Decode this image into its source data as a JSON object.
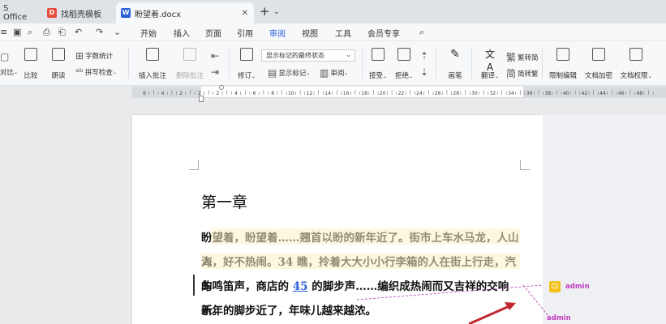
{
  "tabs": [
    {
      "label": "S Office",
      "icon": "wps-office-icon"
    },
    {
      "label": "找稻壳模板",
      "icon": "docer-icon",
      "color": "#e64b3c"
    },
    {
      "label": "盼望着.docx",
      "icon": "word-doc-icon",
      "color": "#2b5fd9",
      "active": true
    }
  ],
  "quick_access": [
    "⌂",
    "⌕",
    "⎙",
    "⎗",
    "↶",
    "↷",
    "⌄"
  ],
  "menu": [
    "开始",
    "插入",
    "页面",
    "引用",
    "审阅",
    "视图",
    "工具",
    "会员专享"
  ],
  "active_menu": "审阅",
  "toolbar": {
    "compare_label": "对比",
    "compare2_label": "比较",
    "read_label": "朗读",
    "word_count": "字数统计",
    "spell_check": "拼写检查",
    "insert_comment": "插入批注",
    "delete_comment": "删除批注",
    "revise": "修订",
    "show_mark": "显示标记",
    "review": "审阅",
    "markup_state": "显示标记的最终状态",
    "accept": "接受",
    "reject": "拒绝",
    "ink": "画笔",
    "translate": "翻译",
    "simp_trad": "繁转简",
    "trad_simp": "简转繁",
    "restrict_edit": "限制编辑",
    "encrypt": "文档加密",
    "doc_rights": "文档权限"
  },
  "ruler_numbers": [
    "6",
    "4",
    "2",
    "2",
    "2",
    "4",
    "6",
    "8",
    "10",
    "12",
    "14",
    "16",
    "18",
    "20",
    "22",
    "24",
    "26",
    "28",
    "30",
    "32",
    "34",
    "36",
    "38",
    "40",
    "42",
    "44",
    "46",
    "48"
  ],
  "document": {
    "heading": "第一章",
    "lines": [
      {
        "pre": "盼望着，盼望着……翘首以盼的新年近了。街市上车水马龙，人山人"
      },
      {
        "pre": "海，好不热闹。34 瞧，拎着大大小小行李箱的人在街上行走，汽车"
      },
      {
        "pre": "的鸣笛声，商店的 ",
        "ins": "45",
        "post": " 的脚步声……编织成热闹而又吉祥的交响乐。"
      },
      {
        "pre": "新年的脚步近了，年味儿越来越浓。"
      }
    ]
  },
  "comments": [
    {
      "author": "admin"
    },
    {
      "author": "admin"
    }
  ],
  "colors": {
    "accent": "#2b5fd9",
    "highlight": "#fbf1c6",
    "comment": "#c03cc0"
  }
}
